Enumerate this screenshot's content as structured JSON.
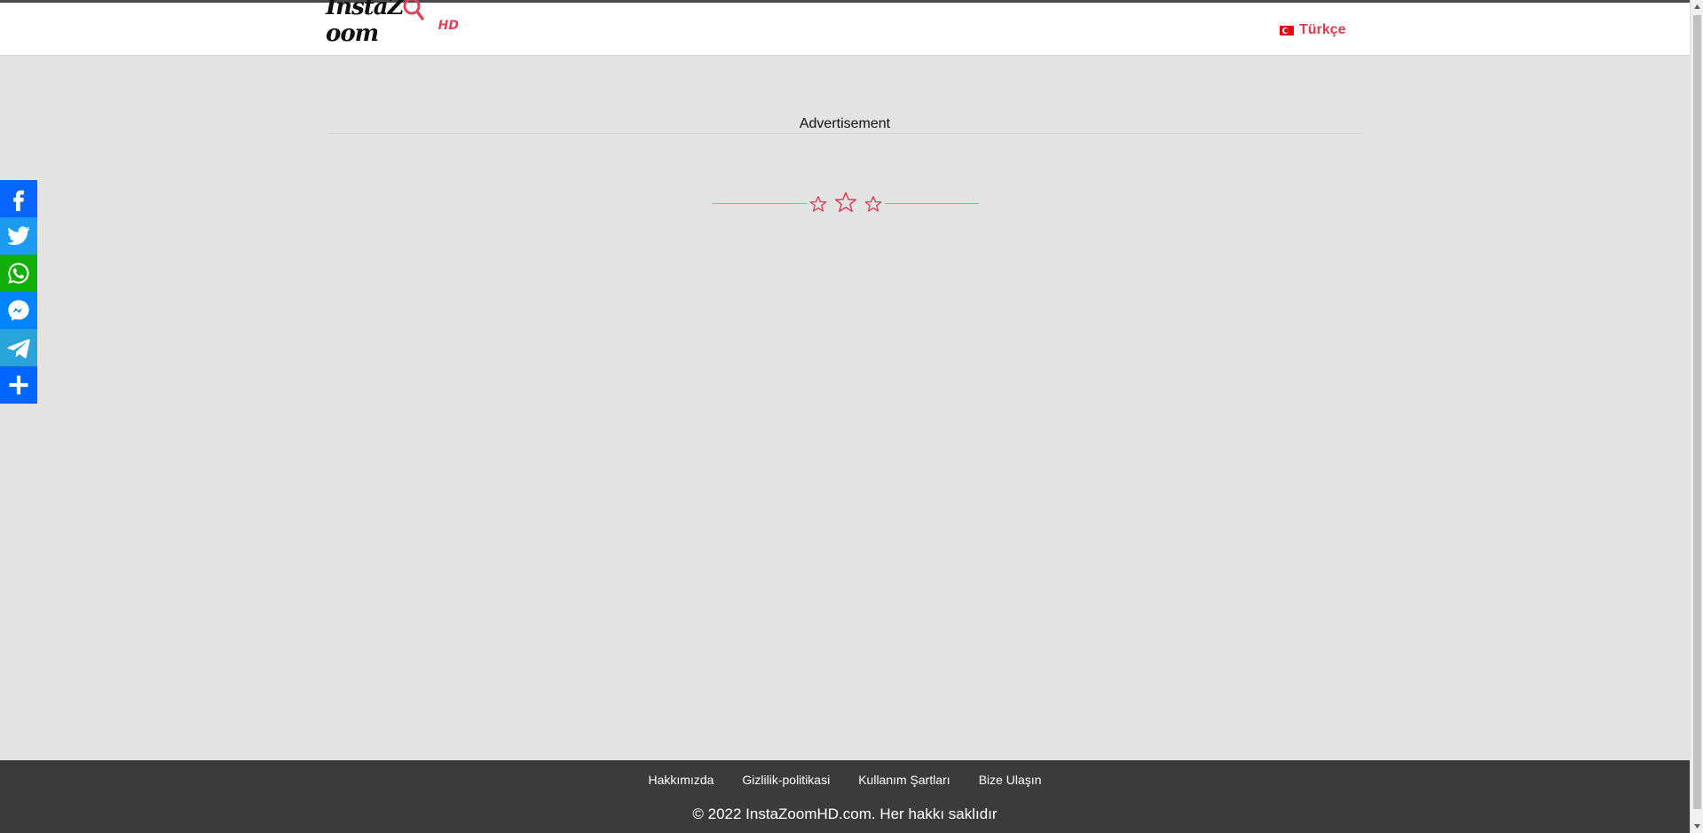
{
  "header": {
    "logo": {
      "text_before": "Insta",
      "text_z": "Z",
      "text_after": "oom",
      "suffix": "HD"
    },
    "language": {
      "label": "Türkçe",
      "flag_icon": "turkey-flag-icon"
    }
  },
  "main": {
    "ad_label": "Advertisement",
    "divider_icon": "three-stars-icon"
  },
  "share_bar": [
    {
      "name": "facebook",
      "icon": "facebook-icon",
      "color": "#0866ff"
    },
    {
      "name": "twitter",
      "icon": "twitter-icon",
      "color": "#1d9bf0"
    },
    {
      "name": "whatsapp",
      "icon": "whatsapp-icon",
      "color": "#12af0a"
    },
    {
      "name": "messenger",
      "icon": "messenger-icon",
      "color": "#0084ff"
    },
    {
      "name": "telegram",
      "icon": "telegram-icon",
      "color": "#2aa2da"
    },
    {
      "name": "more",
      "icon": "plus-icon",
      "color": "#0166ff"
    }
  ],
  "footer": {
    "links": [
      "Hakkımızda",
      "Gizlilik-politikasi",
      "Kullanım Şartları",
      "Bize Ulaşın"
    ],
    "copyright": "© 2022 InstaZoomHD.com. Her hakkı saklıdır"
  },
  "colors": {
    "accent": "#dc3d52",
    "page_bg": "#e3e3e3",
    "footer_bg": "#3b3b3b"
  }
}
